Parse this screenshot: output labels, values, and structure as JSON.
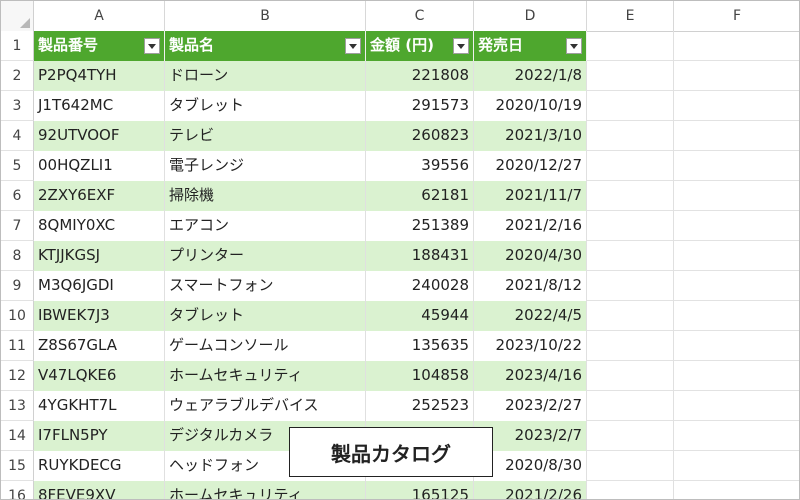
{
  "columns": [
    "A",
    "B",
    "C",
    "D",
    "E",
    "F"
  ],
  "header_row_number": "1",
  "header": [
    "製品番号",
    "製品名",
    "金額 (円)",
    "発売日"
  ],
  "rows": [
    {
      "n": "2",
      "a": "P2PQ4TYH",
      "b": "ドローン",
      "c": "221808",
      "d": "2022/1/8"
    },
    {
      "n": "3",
      "a": "J1T642MC",
      "b": "タブレット",
      "c": "291573",
      "d": "2020/10/19"
    },
    {
      "n": "4",
      "a": "92UTVOOF",
      "b": "テレビ",
      "c": "260823",
      "d": "2021/3/10"
    },
    {
      "n": "5",
      "a": "00HQZLI1",
      "b": "電子レンジ",
      "c": "39556",
      "d": "2020/12/27"
    },
    {
      "n": "6",
      "a": "2ZXY6EXF",
      "b": "掃除機",
      "c": "62181",
      "d": "2021/11/7"
    },
    {
      "n": "7",
      "a": "8QMIY0XC",
      "b": "エアコン",
      "c": "251389",
      "d": "2021/2/16"
    },
    {
      "n": "8",
      "a": "KTJJKGSJ",
      "b": "プリンター",
      "c": "188431",
      "d": "2020/4/30"
    },
    {
      "n": "9",
      "a": "M3Q6JGDI",
      "b": "スマートフォン",
      "c": "240028",
      "d": "2021/8/12"
    },
    {
      "n": "10",
      "a": "IBWEK7J3",
      "b": "タブレット",
      "c": "45944",
      "d": "2022/4/5"
    },
    {
      "n": "11",
      "a": "Z8S67GLA",
      "b": "ゲームコンソール",
      "c": "135635",
      "d": "2023/10/22"
    },
    {
      "n": "12",
      "a": "V47LQKE6",
      "b": "ホームセキュリティ",
      "c": "104858",
      "d": "2023/4/16"
    },
    {
      "n": "13",
      "a": "4YGKHT7L",
      "b": "ウェアラブルデバイス",
      "c": "252523",
      "d": "2023/2/27"
    },
    {
      "n": "14",
      "a": "I7FLN5PY",
      "b": "デジタルカメラ",
      "c": "",
      "d": "2023/2/7"
    },
    {
      "n": "15",
      "a": "RUYKDECG",
      "b": "ヘッドフォン",
      "c": "",
      "d": "2020/8/30"
    },
    {
      "n": "16",
      "a": "8FEVE9XV",
      "b": "ホームセキュリティ",
      "c": "165125",
      "d": "2021/2/26"
    }
  ],
  "textbox": {
    "label": "製品カタログ"
  },
  "colors": {
    "header_green": "#4ea72e",
    "band_green": "#daf2d0"
  }
}
